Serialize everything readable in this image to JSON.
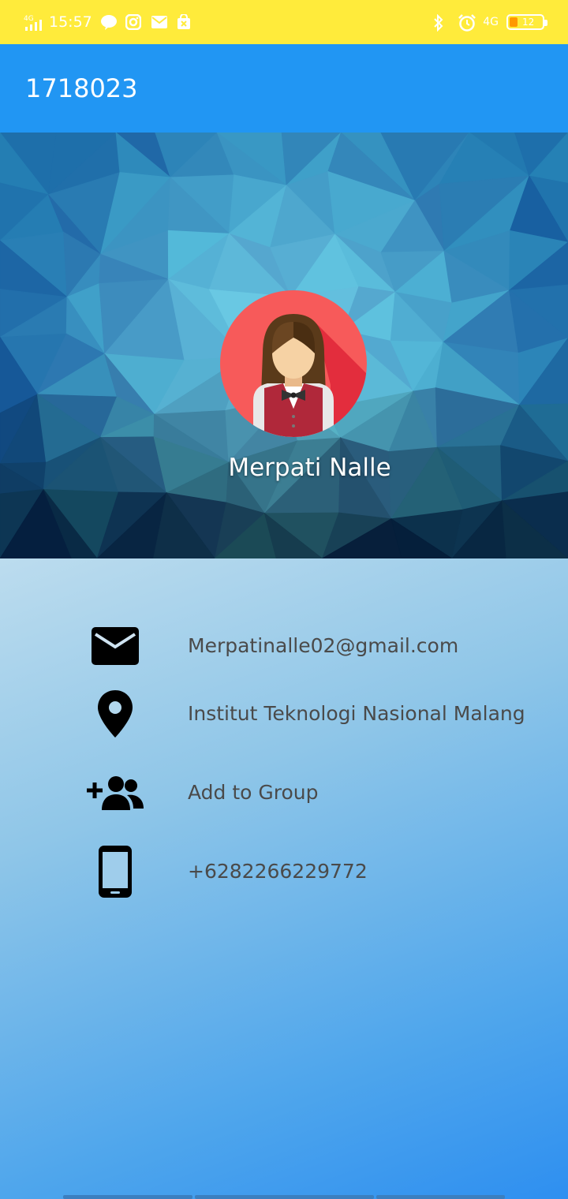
{
  "status_bar": {
    "network": "4G",
    "time": "15:57",
    "network_right": "4G",
    "battery_level": "12",
    "background_color": "#ffeb3b",
    "icons_left": [
      "signal-icon",
      "line-app-icon",
      "instagram-icon",
      "gmail-icon",
      "store-icon"
    ],
    "icons_right": [
      "bluetooth-icon",
      "alarm-icon",
      "battery-icon"
    ]
  },
  "app_bar": {
    "title": "1718023",
    "color": "#2196f3"
  },
  "profile": {
    "name": "Merpati Nalle",
    "avatar_icon": "waitress-avatar-icon"
  },
  "info": {
    "email": "Merpatinalle02@gmail.com",
    "location": "Institut Teknologi Nasional Malang",
    "group": "Add to Group",
    "phone": "+6282266229772"
  }
}
